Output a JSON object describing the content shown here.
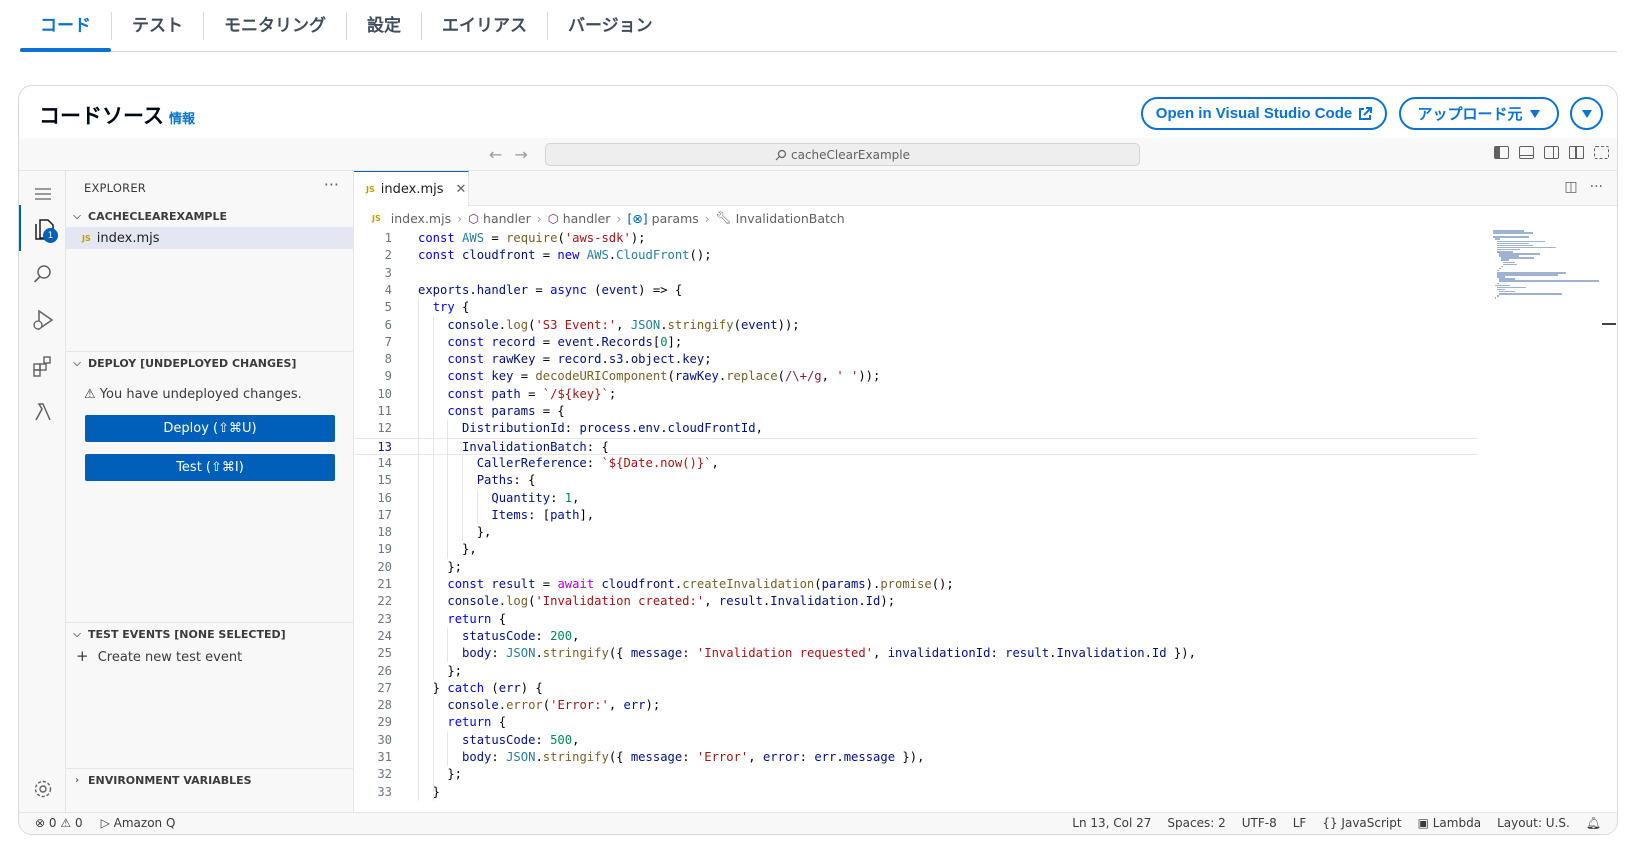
{
  "top_tabs": [
    {
      "label": "コード",
      "active": true
    },
    {
      "label": "テスト",
      "active": false
    },
    {
      "label": "モニタリング",
      "active": false
    },
    {
      "label": "設定",
      "active": false
    },
    {
      "label": "エイリアス",
      "active": false
    },
    {
      "label": "バージョン",
      "active": false
    }
  ],
  "panel": {
    "title": "コードソース",
    "info_link": "情報",
    "vscode_button": "Open in Visual Studio Code",
    "upload_button": "アップロード元"
  },
  "ide": {
    "command_center": "cacheClearExample",
    "explorer_title": "EXPLORER",
    "explorer_badge": "1",
    "folder_name": "CACHECLEAREXAMPLE",
    "file_name": "index.mjs",
    "deploy_section": "DEPLOY [UNDEPLOYED CHANGES]",
    "undeployed_message": "You have undeployed changes.",
    "deploy_button": "Deploy (⇧⌘U)",
    "test_button": "Test (⇧⌘I)",
    "test_events_section": "TEST EVENTS [NONE SELECTED]",
    "create_test_event": "Create new test event",
    "env_vars_section": "ENVIRONMENT VARIABLES",
    "tab_label": "index.mjs",
    "breadcrumbs": [
      "index.mjs",
      "handler",
      "handler",
      "params",
      "InvalidationBatch"
    ],
    "current_line": 13,
    "code_lines": [
      "const AWS = require('aws-sdk');",
      "const cloudfront = new AWS.CloudFront();",
      "",
      "exports.handler = async (event) => {",
      "  try {",
      "    console.log('S3 Event:', JSON.stringify(event));",
      "    const record = event.Records[0];",
      "    const rawKey = record.s3.object.key;",
      "    const key = decodeURIComponent(rawKey.replace(/\\+/g, ' '));",
      "    const path = `/${key}`;",
      "    const params = {",
      "      DistributionId: process.env.cloudFrontId,",
      "      InvalidationBatch: {",
      "        CallerReference: `${Date.now()}`,",
      "        Paths: {",
      "          Quantity: 1,",
      "          Items: [path],",
      "        },",
      "      },",
      "    };",
      "    const result = await cloudfront.createInvalidation(params).promise();",
      "    console.log('Invalidation created:', result.Invalidation.Id);",
      "    return {",
      "      statusCode: 200,",
      "      body: JSON.stringify({ message: 'Invalidation requested', invalidationId: result.Invalidation.Id }),",
      "    };",
      "  } catch (err) {",
      "    console.error('Error:', err);",
      "    return {",
      "      statusCode: 500,",
      "      body: JSON.stringify({ message: 'Error', error: err.message }),",
      "    };",
      "  }"
    ],
    "status_left": {
      "errors": "0",
      "warnings": "0",
      "amazon_q": "Amazon Q"
    },
    "status_right": {
      "position": "Ln 13, Col 27",
      "spaces": "Spaces: 2",
      "encoding": "UTF-8",
      "eol": "LF",
      "language": "JavaScript",
      "runtime": "Lambda",
      "layout": "Layout: U.S."
    }
  },
  "colors": {
    "accent": "#0972d3",
    "ide_accent": "#005fb8"
  }
}
